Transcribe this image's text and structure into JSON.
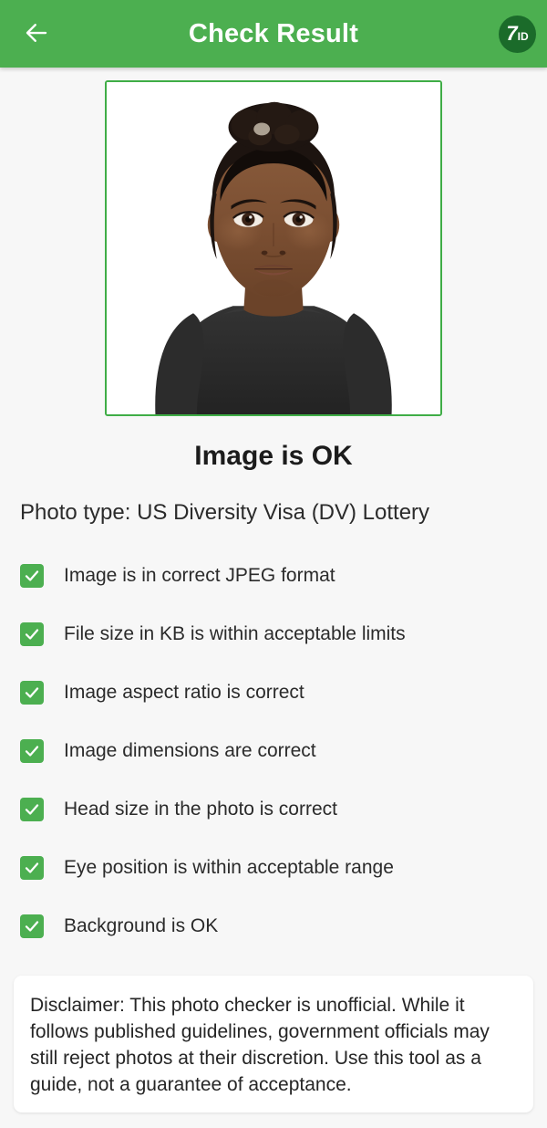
{
  "header": {
    "title": "Check Result",
    "back_icon": "arrow-left-icon",
    "brand": {
      "primary": "7",
      "secondary": "ID",
      "circle_color": "#1b6b2a"
    },
    "background_color": "#4caf50"
  },
  "photo": {
    "border_color": "#3fad46",
    "alt": "passport-style portrait photo of a person on white background"
  },
  "result": {
    "headline": "Image is OK",
    "photo_type": "Photo type: US Diversity Visa (DV) Lottery"
  },
  "checklist": {
    "check_color": "#4caf50",
    "items": [
      {
        "label": "Image is in correct JPEG format",
        "checked": true
      },
      {
        "label": "File size in KB is within acceptable limits",
        "checked": true
      },
      {
        "label": "Image aspect ratio is correct",
        "checked": true
      },
      {
        "label": "Image dimensions are correct",
        "checked": true
      },
      {
        "label": "Head size in the photo is correct",
        "checked": true
      },
      {
        "label": "Eye position is within acceptable range",
        "checked": true
      },
      {
        "label": "Background is OK",
        "checked": true
      }
    ]
  },
  "disclaimer": {
    "text": "Disclaimer: This photo checker is unofficial. While it follows published guidelines, government officials may still reject photos at their discretion. Use this tool as a guide, not a guarantee of acceptance."
  }
}
